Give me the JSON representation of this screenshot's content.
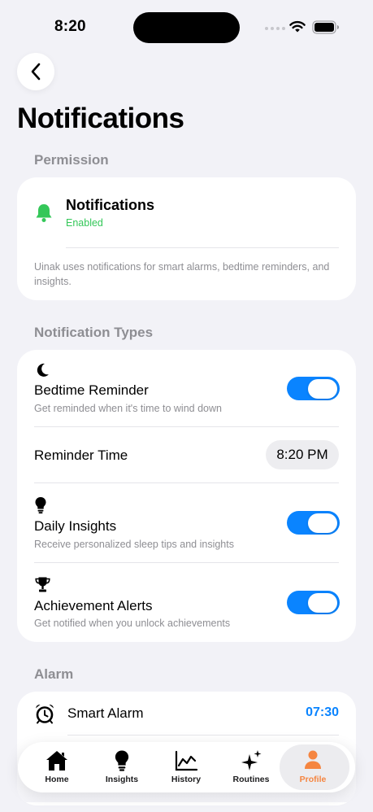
{
  "status_bar": {
    "time": "8:20"
  },
  "header": {
    "title": "Notifications"
  },
  "permission": {
    "section_title": "Permission",
    "title": "Notifications",
    "status": "Enabled",
    "description": "Uinak uses notifications for smart alarms, bedtime reminders, and insights."
  },
  "notification_types": {
    "section_title": "Notification Types",
    "items": [
      {
        "icon": "moon-icon",
        "title": "Bedtime Reminder",
        "subtitle": "Get reminded when it's time to wind down",
        "enabled": true
      },
      {
        "title": "Reminder Time",
        "value": "8:20 PM"
      },
      {
        "icon": "lightbulb-icon",
        "title": "Daily Insights",
        "subtitle": "Receive personalized sleep tips and insights",
        "enabled": true
      },
      {
        "icon": "trophy-icon",
        "title": "Achievement Alerts",
        "subtitle": "Get notified when you unlock achievements",
        "enabled": true
      }
    ]
  },
  "alarm": {
    "section_title": "Alarm",
    "title": "Smart Alarm",
    "time": "07:30"
  },
  "tab_bar": {
    "tabs": [
      {
        "label": "Home",
        "icon": "house-icon"
      },
      {
        "label": "Insights",
        "icon": "lightbulb-icon"
      },
      {
        "label": "History",
        "icon": "chart-icon"
      },
      {
        "label": "Routines",
        "icon": "sparkles-icon"
      },
      {
        "label": "Profile",
        "icon": "person-icon",
        "active": true
      }
    ]
  },
  "colors": {
    "accent_blue": "#0a84ff",
    "enabled_green": "#34c759",
    "active_tab": "#f58540"
  }
}
